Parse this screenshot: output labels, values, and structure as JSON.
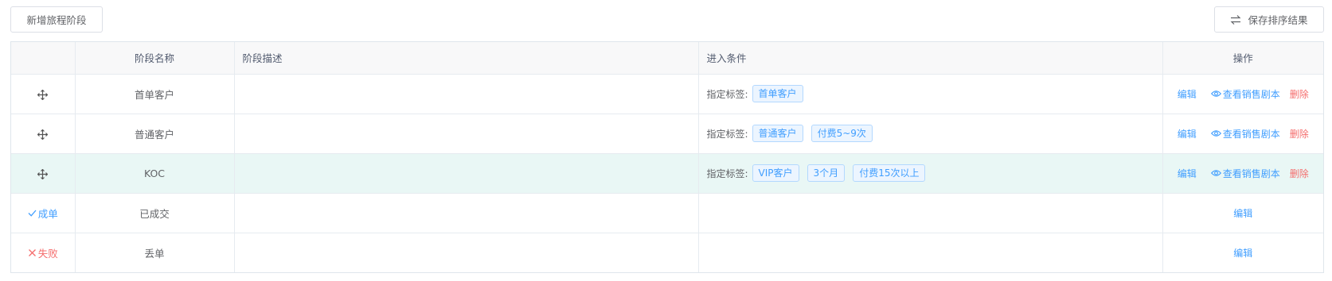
{
  "toolbar": {
    "add_stage_label": "新增旅程阶段",
    "save_sort_label": "保存排序结果",
    "save_sort_icon": "swap-icon"
  },
  "table": {
    "headers": {
      "drag": "",
      "stage_name": "阶段名称",
      "stage_desc": "阶段描述",
      "entry_condition": "进入条件",
      "actions": "操作"
    },
    "rows": [
      {
        "handle_icon": "move-icon",
        "name": "首单客户",
        "description": "",
        "condition_label": "指定标签:",
        "tags": [
          "首单客户"
        ],
        "edit": "编辑",
        "view": "查看销售剧本",
        "delete": "删除",
        "highlighted": false
      },
      {
        "handle_icon": "move-icon",
        "name": "普通客户",
        "description": "",
        "condition_label": "指定标签:",
        "tags": [
          "普通客户",
          "付费5~9次"
        ],
        "edit": "编辑",
        "view": "查看销售剧本",
        "delete": "删除",
        "highlighted": false
      },
      {
        "handle_icon": "move-icon",
        "name": "KOC",
        "description": "",
        "condition_label": "指定标签:",
        "tags": [
          "VIP客户",
          "3个月",
          "付费15次以上"
        ],
        "edit": "编辑",
        "view": "查看销售剧本",
        "delete": "删除",
        "highlighted": true
      },
      {
        "status_label": "成单",
        "status_icon": "check-icon",
        "name": "已成交",
        "description": "",
        "edit": "编辑"
      },
      {
        "status_label": "失败",
        "status_icon": "x-icon",
        "name": "丢单",
        "description": "",
        "edit": "编辑"
      }
    ]
  },
  "colors": {
    "primary": "#409eff",
    "danger": "#f56c6c",
    "highlight_row": "#e9f7f5",
    "header_bg": "#f8f8f9"
  }
}
